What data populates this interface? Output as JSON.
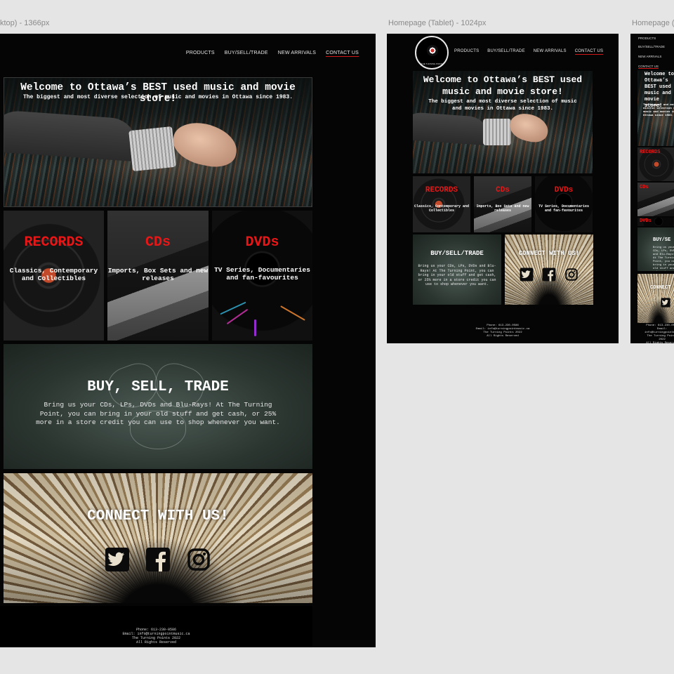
{
  "frames": {
    "desktop_label": "ktop) - 1366px",
    "tablet_label": "Homepage (Tablet) - 1024px",
    "mobile_label": "Homepage ("
  },
  "nav": {
    "products": "PRODUCTS",
    "buy_sell_trade": "BUY/SELL/TRADE",
    "new_arrivals": "NEW ARRIVALS",
    "contact_us": "CONTACT US"
  },
  "logo": {
    "text": "THE TURNING POINT"
  },
  "hero": {
    "title": "Welcome to Ottawa’s BEST used music and movie store!",
    "subtitle": "The biggest and most diverse selection of music and movies in Ottawa since 1983."
  },
  "categories": [
    {
      "title": "RECORDS",
      "desc": "Classics, Contemporary and Collectibles"
    },
    {
      "title": "CDs",
      "desc": "Imports, Box Sets and new releases"
    },
    {
      "title": "DVDs",
      "desc": "TV Series, Documentaries and fan-favourites"
    }
  ],
  "buy_sell_trade": {
    "title_desktop": "BUY, SELL, TRADE",
    "title_tablet": "BUY/SELL/TRADE",
    "title_mobile": "BUY/SE",
    "desc": "Bring us your CDs, LPs, DVDs and Blu-Rays!  At The Turning Point, you can bring in your old stuff and get cash, or 25% more in a store credit you can use to shop whenever you want."
  },
  "connect": {
    "title": "CONNECT WITH US!",
    "title_mobile": "CONNECT"
  },
  "footer": {
    "phone": "Phone: 613-230-0586",
    "email": "Email: info@turningpointmusic.ca",
    "copyright": "The Turning Points 2022",
    "rights": "All Rights Reserved"
  },
  "icons": [
    "twitter-icon",
    "facebook-icon",
    "instagram-icon"
  ],
  "colors": {
    "accent": "#e81616",
    "background": "#050505",
    "canvas": "#e5e5e5"
  }
}
